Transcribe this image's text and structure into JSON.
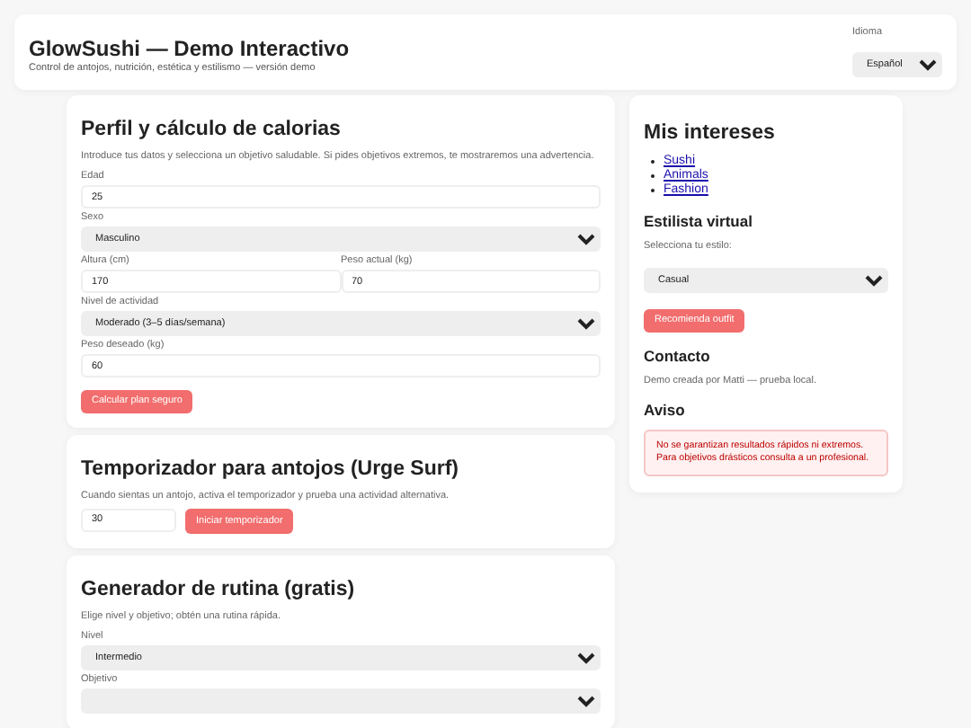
{
  "header": {
    "title": "GlowSushi — Demo Interactivo",
    "subtitle": "Control de antojos, nutrición, estética y estilismo — versión demo",
    "language": {
      "label": "Idioma",
      "value": "Español"
    }
  },
  "sections": [
    {
      "title": "Perfil y cálculo de calorias",
      "intro": "Introduce tus datos y selecciona un objetivo saludable. Si pides objetivos extremos, te mostraremos una advertencia.",
      "fields": [
        {
          "kind": "input",
          "label": "Edad",
          "value": "25"
        },
        {
          "kind": "select",
          "label": "Sexo",
          "value": "Masculino"
        },
        {
          "kind": "pair",
          "fields": [
            {
              "kind": "input",
              "label": "Altura (cm)",
              "value": "170"
            },
            {
              "kind": "input",
              "label": "Peso actual (kg)",
              "value": "70"
            }
          ]
        },
        {
          "kind": "select",
          "label": "Nivel de actividad",
          "value": "Moderado (3–5 días/semana)"
        },
        {
          "kind": "input",
          "label": "Peso deseado (kg)",
          "value": "60"
        }
      ],
      "button": "Calcular plan seguro"
    },
    {
      "title": "Temporizador para antojos (Urge Surf)",
      "intro": "Cuando sientas un antojo, activa el temporizador y prueba una actividad alternativa.",
      "inline": {
        "value": "30",
        "button": "Iniciar temporizador"
      }
    },
    {
      "title": "Generador de rutina (gratis)",
      "intro": "Elige nivel y objetivo; obtén una rutina rápida.",
      "fields": [
        {
          "kind": "select",
          "label": "Nivel",
          "value": "Intermedio"
        },
        {
          "kind": "select",
          "label": "Objetivo"
        }
      ]
    }
  ],
  "sidebar": {
    "title": "Mis intereses",
    "links": [
      "Sushi",
      "Animals",
      "Fashion"
    ],
    "stylist": {
      "heading": "Estilista virtual",
      "prompt": "Selecciona tu estilo:",
      "value": "Casual",
      "button": "Recomienda outfit"
    },
    "contact": {
      "heading": "Contacto",
      "text": "Demo creada por Matti — prueba local."
    },
    "notice": {
      "heading": "Aviso",
      "lines": [
        "No se garantizan resultados rápidos ni extremos.",
        "Para objetivos drásticos consulta a un profesional."
      ]
    }
  }
}
